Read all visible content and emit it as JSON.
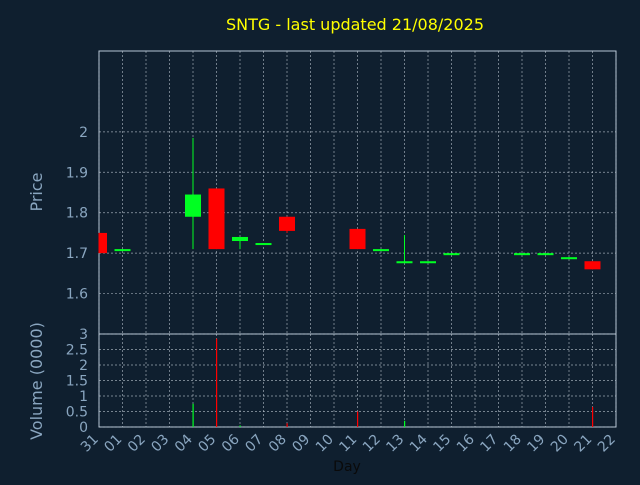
{
  "colors": {
    "background": "#0f1f2f",
    "title": "#ffff00",
    "axis_text": "#8aa6c0",
    "grid": "#c8d2dc",
    "up": "#00ff22",
    "down": "#ff0000",
    "frame": "#b4c4d4"
  },
  "chart_data": [
    {
      "type": "candlestick",
      "title": "SNTG - last updated 21/08/2025",
      "ylabel": "Price",
      "ylim": [
        1.5,
        2.2
      ],
      "yticks": [
        "1.6",
        "1.7",
        "1.8",
        "1.9",
        "2"
      ],
      "grid": true,
      "candles": [
        {
          "x": "31",
          "open": 1.7,
          "close": 1.75,
          "high": 1.75,
          "low": 1.7,
          "dir": "down"
        },
        {
          "x": "01",
          "open": 1.705,
          "close": 1.71,
          "high": 1.71,
          "low": 1.705,
          "dir": "up"
        },
        {
          "x": "04",
          "open": 1.79,
          "close": 1.845,
          "high": 1.985,
          "low": 1.71,
          "dir": "up"
        },
        {
          "x": "05",
          "open": 1.86,
          "close": 1.71,
          "high": 1.86,
          "low": 1.71,
          "dir": "down"
        },
        {
          "x": "06",
          "open": 1.73,
          "close": 1.74,
          "high": 1.74,
          "low": 1.71,
          "dir": "up"
        },
        {
          "x": "07",
          "open": 1.72,
          "close": 1.725,
          "high": 1.725,
          "low": 1.72,
          "dir": "up"
        },
        {
          "x": "08",
          "open": 1.79,
          "close": 1.755,
          "high": 1.79,
          "low": 1.75,
          "dir": "down"
        },
        {
          "x": "11",
          "open": 1.76,
          "close": 1.71,
          "high": 1.76,
          "low": 1.71,
          "dir": "down"
        },
        {
          "x": "12",
          "open": 1.705,
          "close": 1.71,
          "high": 1.71,
          "low": 1.705,
          "dir": "up"
        },
        {
          "x": "13",
          "open": 1.675,
          "close": 1.68,
          "high": 1.745,
          "low": 1.675,
          "dir": "up"
        },
        {
          "x": "14",
          "open": 1.675,
          "close": 1.68,
          "high": 1.68,
          "low": 1.675,
          "dir": "up"
        },
        {
          "x": "15",
          "open": 1.695,
          "close": 1.7,
          "high": 1.7,
          "low": 1.695,
          "dir": "up"
        },
        {
          "x": "18",
          "open": 1.695,
          "close": 1.7,
          "high": 1.7,
          "low": 1.695,
          "dir": "up"
        },
        {
          "x": "19",
          "open": 1.695,
          "close": 1.7,
          "high": 1.7,
          "low": 1.695,
          "dir": "up"
        },
        {
          "x": "20",
          "open": 1.685,
          "close": 1.69,
          "high": 1.69,
          "low": 1.685,
          "dir": "up"
        },
        {
          "x": "21",
          "open": 1.68,
          "close": 1.66,
          "high": 1.68,
          "low": 1.66,
          "dir": "down"
        }
      ]
    },
    {
      "type": "bar",
      "ylabel": "Volume (0000)",
      "xlabel": "Day",
      "ylim": [
        0,
        3
      ],
      "yticks": [
        "0",
        "0.5",
        "1",
        "1.5",
        "2",
        "2.5",
        "3"
      ],
      "grid": true,
      "categories": [
        "31",
        "01",
        "02",
        "03",
        "04",
        "05",
        "06",
        "07",
        "08",
        "09",
        "10",
        "11",
        "12",
        "13",
        "14",
        "15",
        "16",
        "17",
        "18",
        "19",
        "20",
        "21",
        "22"
      ],
      "bars": [
        {
          "x": "04",
          "value": 0.75,
          "dir": "up"
        },
        {
          "x": "05",
          "value": 2.85,
          "dir": "down"
        },
        {
          "x": "06",
          "value": 0.05,
          "dir": "up"
        },
        {
          "x": "08",
          "value": 0.12,
          "dir": "down"
        },
        {
          "x": "11",
          "value": 0.5,
          "dir": "down"
        },
        {
          "x": "13",
          "value": 0.2,
          "dir": "up"
        },
        {
          "x": "21",
          "value": 0.65,
          "dir": "down"
        }
      ]
    }
  ]
}
